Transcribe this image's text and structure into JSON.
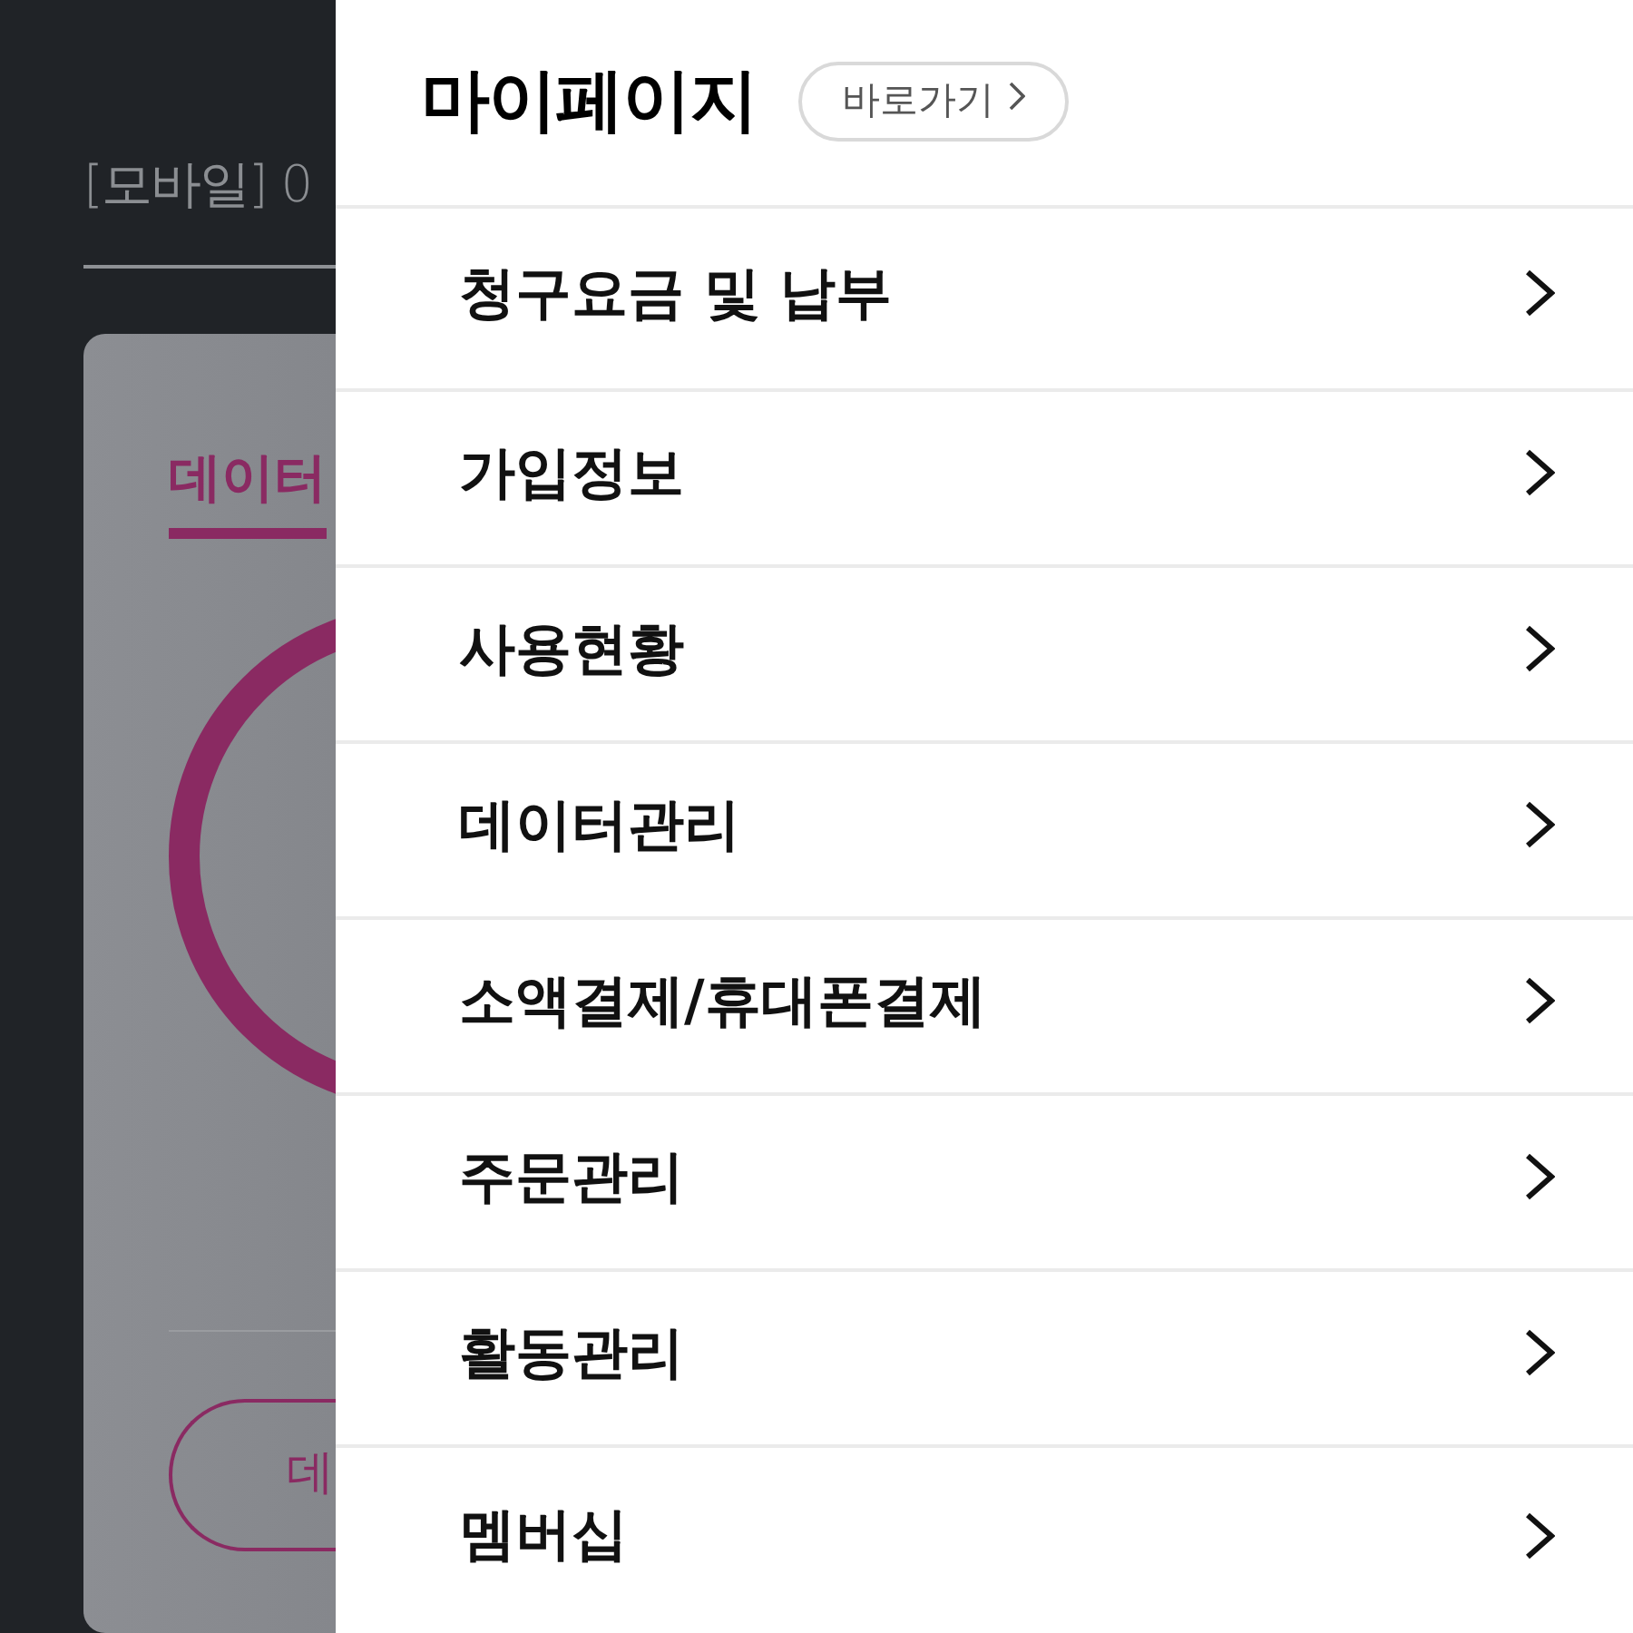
{
  "background_page": {
    "title": "[모바일] 0",
    "tabs": [
      {
        "label": "데이터",
        "selected": true
      }
    ],
    "button": {
      "label": "데"
    }
  },
  "drawer": {
    "title": "마이페이지",
    "shortcut_button": {
      "label": "바로가기"
    },
    "menu_items": [
      {
        "label": "청구요금 및 납부"
      },
      {
        "label": "가입정보"
      },
      {
        "label": "사용현황"
      },
      {
        "label": "데이터관리"
      },
      {
        "label": "소액결제/휴대폰결제"
      },
      {
        "label": "주문관리"
      },
      {
        "label": "활동관리"
      },
      {
        "label": "멤버십"
      }
    ]
  }
}
